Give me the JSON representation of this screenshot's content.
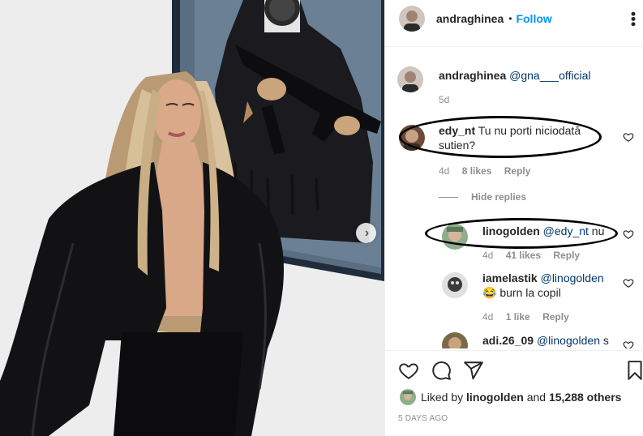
{
  "post": {
    "author": "andraghinea",
    "separator": "•",
    "follow_label": "Follow",
    "more_icon": "more-options-icon",
    "time_ago": "5 DAYS AGO"
  },
  "caption": {
    "user": "andraghinea",
    "mention": "@gna___official",
    "age": "5d"
  },
  "comments": [
    {
      "user": "edy_nt",
      "text_line1": "Tu nu porti niciodată",
      "text_line2": "sutien?",
      "age": "4d",
      "likes": "8 likes",
      "reply": "Reply"
    },
    {
      "user": "linogolden",
      "mention": "@edy_nt",
      "text": "nu",
      "age": "4d",
      "likes": "41 likes",
      "reply": "Reply"
    },
    {
      "user": "iamelastik",
      "mention": "@linogolden",
      "emoji": "😂",
      "text": "burn la copil",
      "age": "4d",
      "likes": "1 like",
      "reply": "Reply"
    },
    {
      "user": "adi.26_09",
      "mention": "@linogolden",
      "text": "s"
    }
  ],
  "hide_replies": "Hide replies",
  "likes": {
    "prefix": "Liked by",
    "user": "linogolden",
    "joiner": "and",
    "others": "15,288 others"
  },
  "colors": {
    "accent": "#0095f6",
    "mention": "#00376b",
    "muted": "#8e8e8e"
  }
}
